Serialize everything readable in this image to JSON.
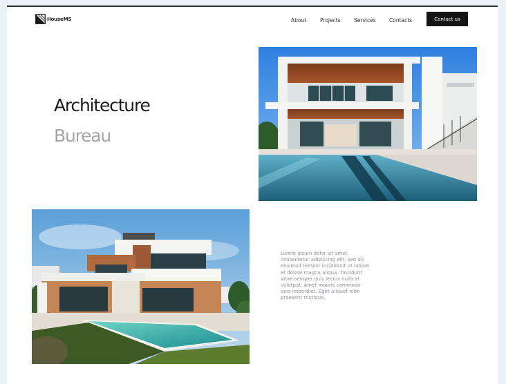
{
  "brand": {
    "name": "HouseMS",
    "logo_icon": "house-logo-icon"
  },
  "nav": {
    "items": [
      {
        "label": "About"
      },
      {
        "label": "Projects"
      },
      {
        "label": "Services"
      },
      {
        "label": "Contacts"
      }
    ],
    "cta_label": "Contact us"
  },
  "hero": {
    "title": "Architecture",
    "subtitle": "Bureau"
  },
  "content": {
    "paragraph": "Lorem ipsum dolor sit amet, consectetur adipiscing elit, sed do eiusmod tempor incididunt ut labore et dolore magna aliqua. Tincidunt vitae semper quis lectus nulla at volutpat. Amet mauris commodo quis imperdiet. Eget aliquet nibh praesent tristique."
  },
  "images": {
    "primary": "modern-villa-with-pool-photo",
    "secondary": "modern-house-with-pool-photo"
  },
  "colors": {
    "background": "#e8f2f5",
    "page": "#ffffff",
    "accent_dark": "#141414",
    "subtitle_gray": "#a6a5ad",
    "paragraph_gray": "#8f8f99"
  }
}
